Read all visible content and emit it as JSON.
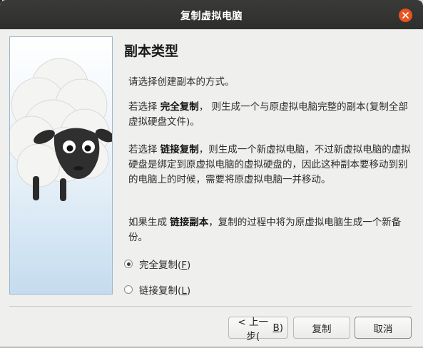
{
  "window": {
    "title": "复制虚拟电脑"
  },
  "page": {
    "title": "副本类型",
    "intro": "请选择创建副本的方式。",
    "full_prefix": "若选择 ",
    "full_bold": "完全复制",
    "full_text": "， 则生成一个与原虚拟电脑完整的副本(复制全部虚拟硬盘文件)。",
    "linked_prefix": "若选择 ",
    "linked_bold": "链接复制",
    "linked_text": "，则生成一个新虚拟电脑，不过新虚拟电脑的虚拟硬盘是绑定到原虚拟电脑的虚拟硬盘的，因此这种副本要移动到别的电脑上的时候，需要将原虚拟电脑一并移动。",
    "snap_prefix": "如果生成 ",
    "snap_bold": "链接副本",
    "snap_text": "，复制的过程中将为原虚拟电脑生成一个新备份。"
  },
  "options": {
    "full_label": "完全复制(",
    "full_key": "F",
    "full_suffix": ")",
    "full_checked": true,
    "linked_label": "链接复制(",
    "linked_key": "L",
    "linked_suffix": ")",
    "linked_checked": false
  },
  "buttons": {
    "back": "< 上一步(",
    "back_key": "B",
    "back_suffix": ")",
    "clone": "复制",
    "cancel": "取消"
  },
  "colors": {
    "titlebar": "#2e2e2c",
    "close_button": "#e95420",
    "window_bg": "#efefed"
  },
  "icons": {
    "close": "close-icon",
    "banner": "sheep-illustration"
  }
}
